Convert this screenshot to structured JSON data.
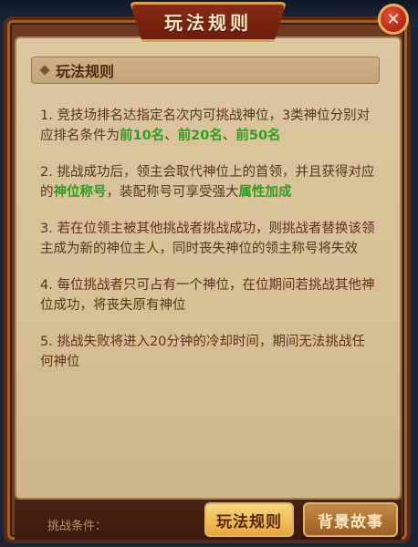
{
  "header": {
    "title": "玩法规则",
    "close_icon": "close-icon"
  },
  "section": {
    "title": "玩法规则"
  },
  "rules": [
    {
      "text_a": "1. 竞技场排名达指定名次内可挑战神位，3类神位分别对应排名条件为",
      "hl1": "前10名",
      "sep1": "、",
      "hl2": "前20名",
      "sep2": "、",
      "hl3": "前50名"
    },
    {
      "text_a": "2. 挑战成功后，领主会取代神位上的首领，并且获得对应的",
      "hl1": "神位称号",
      "text_b": "，装配称号可享受强大",
      "hl2": "属性加成"
    },
    {
      "text": "3. 若在位领主被其他挑战者挑战成功，则挑战者替换该领主成为新的神位主人，同时丧失神位的领主称号将失效"
    },
    {
      "text": "4. 每位挑战者只可占有一个神位，在位期间若挑战其他神位成功，将丧失原有神位"
    },
    {
      "text": "5. 挑战失败将进入20分钟的冷却时间，期间无法挑战任何神位"
    }
  ],
  "footer": {
    "condition_label": "挑战条件：",
    "rules_button": "玩法规则",
    "story_button": "背景故事"
  },
  "colors": {
    "highlight": "#2f9c22",
    "text": "#5a3418",
    "paper": "#d7bf96"
  }
}
